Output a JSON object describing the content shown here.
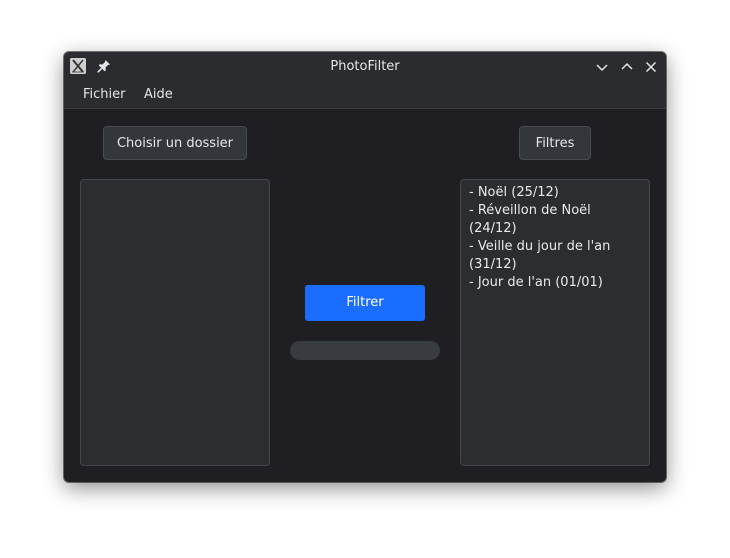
{
  "window": {
    "title": "PhotoFilter"
  },
  "menu": {
    "items": [
      {
        "label": "Fichier"
      },
      {
        "label": "Aide"
      }
    ]
  },
  "toolbar": {
    "choose_folder_label": "Choisir un dossier",
    "filters_label": "Filtres"
  },
  "action": {
    "filter_label": "Filtrer"
  },
  "progress": {
    "value": 0
  },
  "filters": {
    "items": [
      "- Noël (25/12)",
      "- Réveillon de Noël (24/12)",
      "- Veille du jour de l'an (31/12)",
      "- Jour de l'an (01/01)"
    ]
  },
  "colors": {
    "accent": "#1a6dff",
    "window_bg": "#1f1f23",
    "panel_bg": "#2b2d31"
  }
}
